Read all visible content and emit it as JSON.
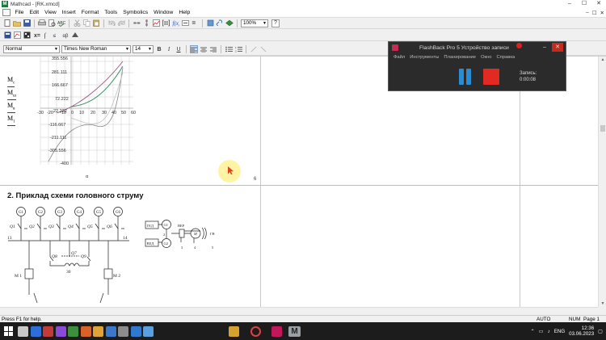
{
  "window": {
    "title": "Mathcad - [RK.xmcd]",
    "app_icon_glyph": "M",
    "buttons": [
      "–",
      "☐",
      "✕"
    ]
  },
  "menu": {
    "items": [
      "File",
      "Edit",
      "View",
      "Insert",
      "Format",
      "Tools",
      "Symbolics",
      "Window",
      "Help"
    ],
    "mdi_buttons": [
      "–",
      "☐",
      "✕"
    ]
  },
  "toolbar": {
    "zoom": "100%",
    "help_glyph": "?"
  },
  "format_bar": {
    "style": "Normal",
    "font": "Times New Roman",
    "size": "14",
    "bold": "B",
    "italic": "I",
    "underline": "U"
  },
  "document": {
    "side_labels": [
      {
        "main": "M",
        "sub": "c"
      },
      {
        "main": "M",
        "sub": "ш"
      },
      {
        "main": "M",
        "sub": "в"
      },
      {
        "main": "M",
        "sub": "1"
      }
    ],
    "plot": {
      "y_ticks": [
        "355.556",
        "281.111",
        "166.667",
        "72.222",
        "22.222",
        "-116.667",
        "-211.111",
        "-305.556",
        "-400"
      ],
      "x_ticks": [
        "-30",
        "-20",
        "-10",
        "0",
        "10",
        "20",
        "30",
        "40",
        "50",
        "60"
      ],
      "below_label": "α"
    },
    "page_number": "6",
    "section_title": "2. Приклад схеми головного струму",
    "scheme_left": {
      "gens": [
        "G1",
        "G2",
        "G3",
        "G4",
        "G5",
        "G6"
      ],
      "switches": [
        "Q1",
        "Q2",
        "Q3",
        "Q4",
        "Q5",
        "Q6"
      ],
      "bus_left": "13",
      "bus_right": "14",
      "mid_labels": [
        "Q7",
        "Q8",
        "Q9",
        "30"
      ],
      "bottom_labels": [
        "M 1",
        "M 2"
      ]
    },
    "scheme_right": {
      "boxes": [
        "ГЕД",
        "ВЕД"
      ],
      "gen_labels": [
        "G1",
        "G2"
      ],
      "line_labels": [
        "ВЕР",
        "M",
        "ГВ"
      ],
      "numbers": [
        "2",
        "3",
        "4",
        "5"
      ]
    }
  },
  "statusbar": {
    "help": "Press F1 for help.",
    "auto": "AUTO",
    "num": "NUM",
    "page": "Page 1"
  },
  "taskbar": {
    "lang": "ENG",
    "time": "12:36",
    "date": "03.06.2023",
    "app_colors": [
      "#c9c9c9",
      "#2d6fd6",
      "#c23b3b",
      "#8a4bd6",
      "#3d8f3d",
      "#d8622a",
      "#e0a33a",
      "#3b78c9",
      "#8c8c8c",
      "#2f7ad0",
      "#d6a12f",
      "#e04040",
      "#c2185b",
      "#9aa0a6"
    ]
  },
  "flashback": {
    "title": "FlashBack Pro 5 Устройство записи",
    "menu": [
      "Файл",
      "Инструменты",
      "Планирование",
      "Окно",
      "Справка"
    ],
    "rec_label": "Запись:",
    "rec_time": "0:00:08",
    "buttons": [
      "–",
      "✕"
    ],
    "accent": "#2b8cd6",
    "stop_color": "#e22a22"
  }
}
